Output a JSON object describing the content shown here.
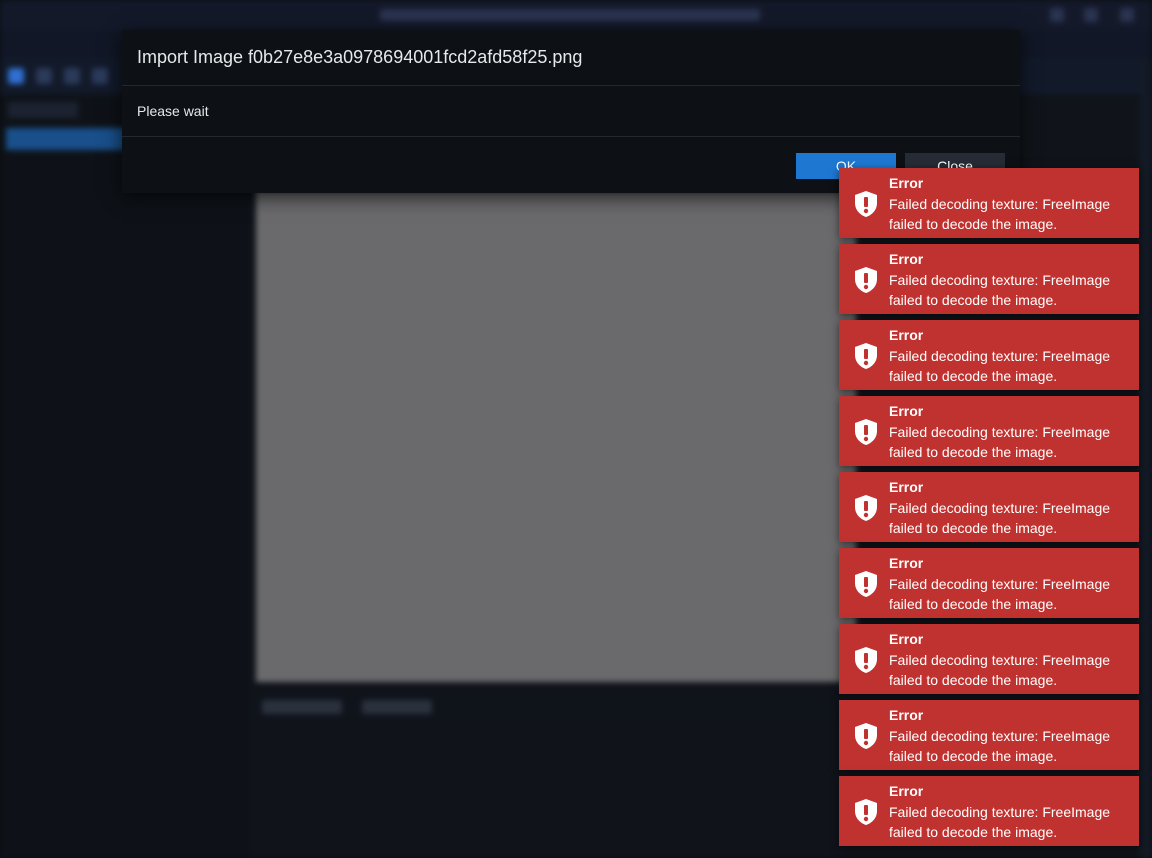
{
  "dialog": {
    "title": "Import Image f0b27e8e3a0978694001fcd2afd58f25.png",
    "body": "Please wait",
    "ok_label": "OK",
    "close_label": "Close"
  },
  "toasts": [
    {
      "title": "Error",
      "message": "Failed decoding texture: FreeImage failed to decode the image."
    },
    {
      "title": "Error",
      "message": "Failed decoding texture: FreeImage failed to decode the image."
    },
    {
      "title": "Error",
      "message": "Failed decoding texture: FreeImage failed to decode the image."
    },
    {
      "title": "Error",
      "message": "Failed decoding texture: FreeImage failed to decode the image."
    },
    {
      "title": "Error",
      "message": "Failed decoding texture: FreeImage failed to decode the image."
    },
    {
      "title": "Error",
      "message": "Failed decoding texture: FreeImage failed to decode the image."
    },
    {
      "title": "Error",
      "message": "Failed decoding texture: FreeImage failed to decode the image."
    },
    {
      "title": "Error",
      "message": "Failed decoding texture: FreeImage failed to decode the image."
    },
    {
      "title": "Error",
      "message": "Failed decoding texture: FreeImage failed to decode the image."
    }
  ],
  "colors": {
    "toast_bg": "#c0322f",
    "ok_button": "#1e78d2",
    "close_button": "#252c36",
    "dialog_bg": "#0d1014"
  },
  "icons": {
    "toast": "shield-exclamation-icon"
  }
}
